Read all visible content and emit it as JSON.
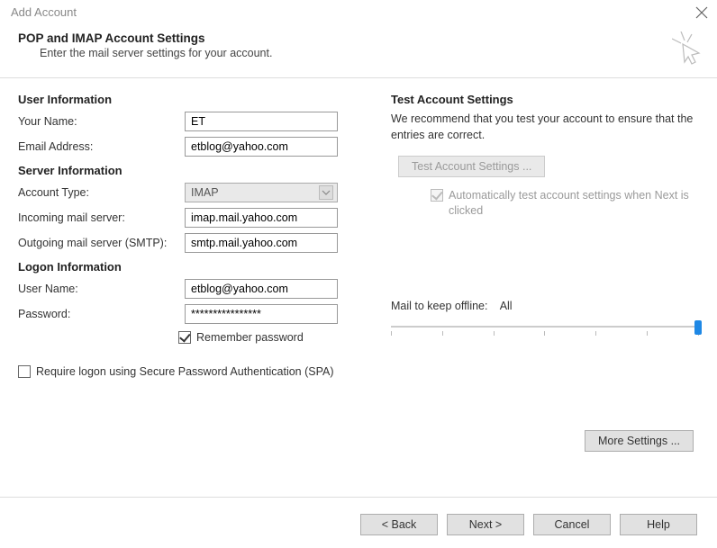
{
  "window": {
    "title": "Add Account"
  },
  "header": {
    "title": "POP and IMAP Account Settings",
    "subtitle": "Enter the mail server settings for your account."
  },
  "left": {
    "userInfoHeading": "User Information",
    "yourNameLabel": "Your Name:",
    "yourNameValue": "ET",
    "emailLabel": "Email Address:",
    "emailValue": "etblog@yahoo.com",
    "serverInfoHeading": "Server Information",
    "accountTypeLabel": "Account Type:",
    "accountTypeValue": "IMAP",
    "incomingLabel": "Incoming mail server:",
    "incomingValue": "imap.mail.yahoo.com",
    "outgoingLabel": "Outgoing mail server (SMTP):",
    "outgoingValue": "smtp.mail.yahoo.com",
    "logonInfoHeading": "Logon Information",
    "userNameLabel": "User Name:",
    "userNameValue": "etblog@yahoo.com",
    "passwordLabel": "Password:",
    "passwordValue": "****************",
    "rememberLabel": "Remember password",
    "spaLabel": "Require logon using Secure Password Authentication (SPA)"
  },
  "right": {
    "testHeading": "Test Account Settings",
    "testPara": "We recommend that you test your account to ensure that the entries are correct.",
    "testBtn": "Test Account Settings ...",
    "autoTest": "Automatically test account settings when Next is clicked",
    "mailOfflineLabel": "Mail to keep offline:",
    "mailOfflineValue": "All",
    "moreSettings": "More Settings ..."
  },
  "buttons": {
    "back": "< Back",
    "next": "Next >",
    "cancel": "Cancel",
    "help": "Help"
  }
}
